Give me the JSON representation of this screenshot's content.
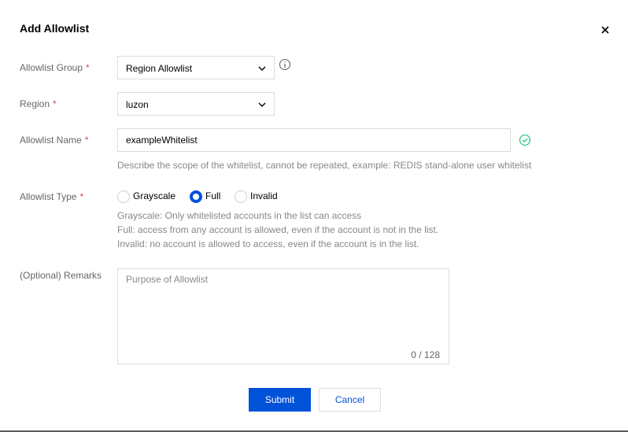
{
  "dialog": {
    "title": "Add Allowlist",
    "close_icon": "close-icon"
  },
  "form": {
    "required_mark": "*",
    "allowlist_group": {
      "label": "Allowlist Group",
      "value": "Region Allowlist",
      "info_icon": "info-icon"
    },
    "region": {
      "label": "Region",
      "value": "luzon"
    },
    "allowlist_name": {
      "label": "Allowlist Name",
      "value": "exampleWhitelist",
      "valid_icon": "check-circle-icon",
      "hint": "Describe the scope of the whitelist, cannot be repeated, example: REDIS stand-alone user whitelist"
    },
    "allowlist_type": {
      "label": "Allowlist Type",
      "options": [
        {
          "label": "Grayscale",
          "checked": false
        },
        {
          "label": "Full",
          "checked": true
        },
        {
          "label": "Invalid",
          "checked": false
        }
      ],
      "descriptions": [
        "Grayscale: Only whitelisted accounts in the list can access",
        "Full: access from any account is allowed, even if the account is not in the list.",
        "Invalid: no account is allowed to access, even if the account is in the list."
      ]
    },
    "remarks": {
      "label": "(Optional) Remarks",
      "placeholder": "Purpose of Allowlist",
      "value": "",
      "counter": "0 / 128"
    }
  },
  "actions": {
    "submit_label": "Submit",
    "cancel_label": "Cancel"
  },
  "colors": {
    "primary": "#0052d9",
    "required": "#e54545",
    "success": "#29cc85"
  }
}
